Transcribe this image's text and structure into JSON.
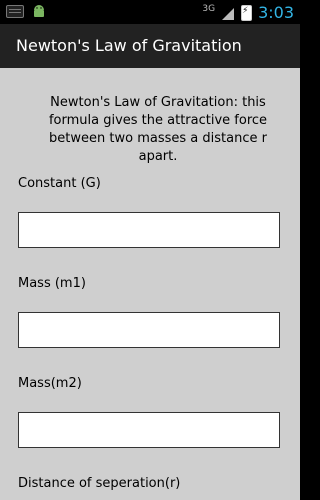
{
  "status_bar": {
    "network": "3G",
    "time": "3:03"
  },
  "action_bar": {
    "title": "Newton's Law of Gravitation"
  },
  "form": {
    "description": "Newton's Law of Gravitation: this formula gives the attractive force between two masses a distance r apart.",
    "fields": [
      {
        "label": "Constant  (G)",
        "value": ""
      },
      {
        "label": "Mass  (m1)",
        "value": ""
      },
      {
        "label": "Mass(m2)",
        "value": ""
      },
      {
        "label": "Distance of seperation(r)",
        "value": ""
      }
    ]
  },
  "colors": {
    "clock": "#33b5e5",
    "background": "#cfcfcf",
    "action_bar": "#222222"
  },
  "icons": [
    "keyboard-icon",
    "android-icon",
    "signal-icon",
    "battery-icon"
  ]
}
